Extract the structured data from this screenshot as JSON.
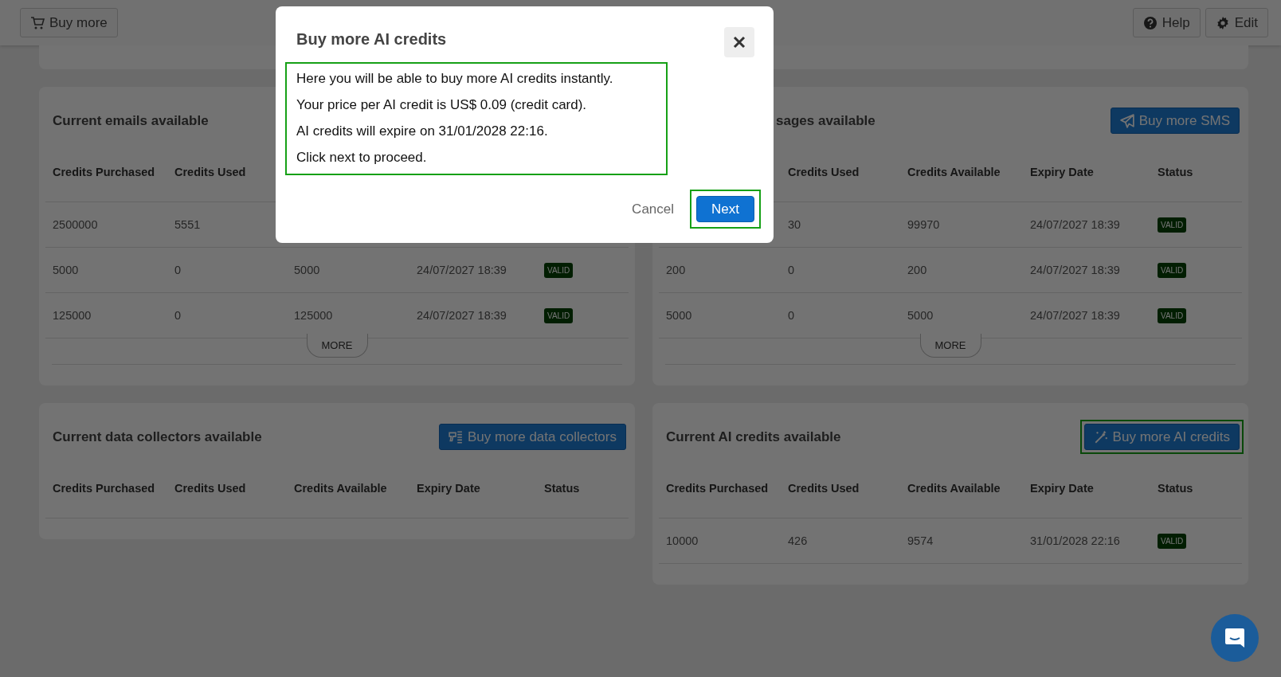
{
  "toolbar": {
    "buy_more": "Buy more",
    "help": "Help",
    "edit": "Edit"
  },
  "cards": [
    {
      "title": "Current emails available",
      "columns": [
        {
          "label": "Credits Purchased"
        },
        {
          "label": "Credits Used"
        },
        {},
        {},
        {}
      ],
      "rows": [
        {
          "cells": [
            "2500000",
            "5551",
            null,
            null
          ]
        },
        {
          "cells": [
            "5000",
            "0",
            "5000",
            "24/07/2027 18:39"
          ],
          "status": "VALID"
        },
        {
          "cells": [
            "125000",
            "0",
            "125000",
            "24/07/2027 18:39"
          ],
          "status": "VALID"
        }
      ],
      "more": "MORE"
    },
    {
      "title": "sages available",
      "button": {
        "label": "Buy more SMS",
        "kind": "sms",
        "highlighted": false
      },
      "columns": [
        {},
        {
          "label": "Credits Used"
        },
        {
          "label": "Credits Available"
        },
        {
          "label": "Expiry Date"
        },
        {
          "label": "Status"
        }
      ],
      "rows": [
        {
          "cells": [
            null,
            "30",
            "99970",
            "24/07/2027 18:39"
          ],
          "status": "VALID"
        },
        {
          "cells": [
            "200",
            "0",
            "200",
            "24/07/2027 18:39"
          ],
          "status": "VALID"
        },
        {
          "cells": [
            "5000",
            "0",
            "5000",
            "24/07/2027 18:39"
          ],
          "status": "VALID"
        }
      ],
      "more": "MORE"
    },
    {
      "title": "Current data collectors available",
      "button": {
        "label": "Buy more data collectors",
        "kind": "collectors",
        "highlighted": false
      },
      "columns": [
        {
          "label": "Credits Purchased"
        },
        {
          "label": "Credits Used"
        },
        {
          "label": "Credits Available"
        },
        {
          "label": "Expiry Date"
        },
        {
          "label": "Status"
        }
      ]
    },
    {
      "title": "Current AI credits available",
      "button": {
        "label": "Buy more AI credits",
        "kind": "ai",
        "highlighted": true
      },
      "columns": [
        {
          "label": "Credits Purchased"
        },
        {
          "label": "Credits Used"
        },
        {
          "label": "Credits Available"
        },
        {
          "label": "Expiry Date"
        },
        {
          "label": "Status"
        }
      ],
      "rows": [
        {
          "cells": [
            "10000",
            "426",
            "9574",
            "31/01/2028 22:16"
          ],
          "status": "VALID"
        }
      ]
    }
  ],
  "dialog": {
    "title": "Buy more AI credits",
    "messages_highlighted": true,
    "messages": [
      "Here you will be able to buy more AI credits instantly.",
      "Your price per AI credit is US$ 0.09 (credit card).",
      "AI credits will expire on 31/01/2028 22:16.",
      "Click next to proceed."
    ],
    "cancel": "Cancel",
    "next": {
      "label": "Next",
      "highlighted": true
    }
  }
}
